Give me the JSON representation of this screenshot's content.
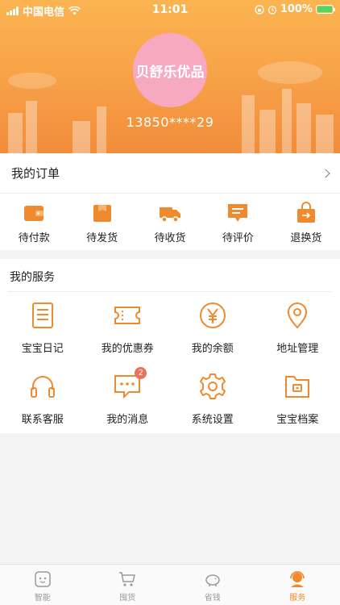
{
  "status_bar": {
    "carrier": "中国电信",
    "time": "11:01",
    "battery": "100%"
  },
  "profile": {
    "avatar_text": "贝舒乐优品",
    "phone": "13850****29"
  },
  "orders": {
    "title": "我的订单",
    "items": [
      {
        "label": "待付款",
        "icon": "wallet-icon"
      },
      {
        "label": "待发货",
        "icon": "package-icon"
      },
      {
        "label": "待收货",
        "icon": "truck-icon"
      },
      {
        "label": "待评价",
        "icon": "comment-icon"
      },
      {
        "label": "退换货",
        "icon": "return-bag-icon"
      }
    ]
  },
  "services": {
    "title": "我的服务",
    "items": [
      {
        "label": "宝宝日记",
        "icon": "diary-icon"
      },
      {
        "label": "我的优惠券",
        "icon": "coupon-icon"
      },
      {
        "label": "我的余额",
        "icon": "yuan-icon"
      },
      {
        "label": "地址管理",
        "icon": "location-pin-icon"
      },
      {
        "label": "联系客服",
        "icon": "headphones-icon"
      },
      {
        "label": "我的消息",
        "icon": "message-icon",
        "badge": "2"
      },
      {
        "label": "系统设置",
        "icon": "gear-icon"
      },
      {
        "label": "宝宝档案",
        "icon": "folder-icon"
      }
    ]
  },
  "tabbar": {
    "items": [
      {
        "label": "智能",
        "icon": "baby-face-icon",
        "active": false
      },
      {
        "label": "囤货",
        "icon": "cart-icon",
        "active": false
      },
      {
        "label": "省钱",
        "icon": "piggy-bank-icon",
        "active": false
      },
      {
        "label": "服务",
        "icon": "service-agent-icon",
        "active": true
      }
    ]
  },
  "colors": {
    "accent": "#f08a2e",
    "header_top": "#fbb451",
    "header_bottom": "#f28c3a",
    "avatar_bg": "#f8a9c2",
    "badge": "#ef6f5a"
  }
}
